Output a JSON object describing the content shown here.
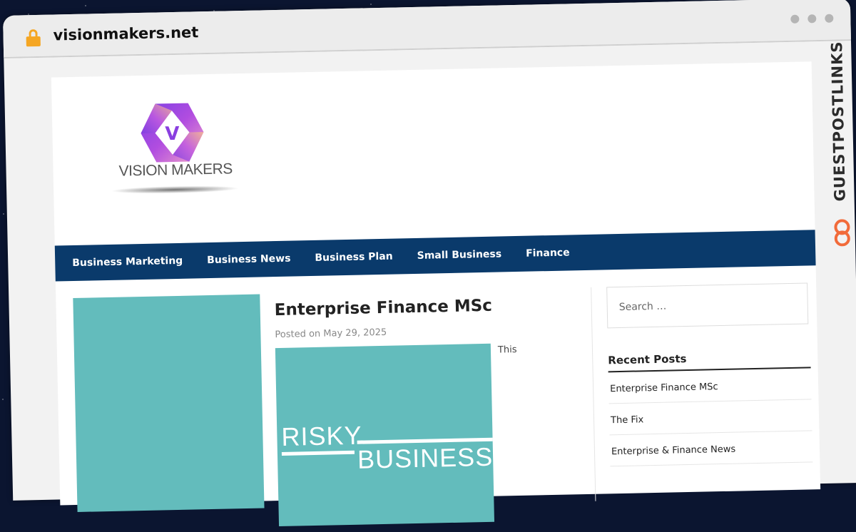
{
  "browser": {
    "url": "visionmakers.net"
  },
  "site": {
    "logo_text": "VISION MAKERS",
    "logo_letter": "V",
    "nav": [
      "Business Marketing",
      "Business News",
      "Business Plan",
      "Small Business",
      "Finance"
    ]
  },
  "post": {
    "title": "Enterprise Finance MSc",
    "meta": "Posted on May 29, 2025",
    "image_line1": "RISKY",
    "image_line2": "BUSINESS",
    "excerpt": "This"
  },
  "sidebar": {
    "search_placeholder": "Search …",
    "recent_title": "Recent Posts",
    "recent": [
      "Enterprise Finance MSc",
      "The Fix",
      "Enterprise & Finance News"
    ]
  },
  "watermark": {
    "text": "GUESTPOSTLINKS"
  },
  "colors": {
    "nav_bg": "#0a3a6b",
    "teal": "#63bcbc",
    "lock": "#f5a623",
    "watermark_icon": "#f26b3a"
  }
}
